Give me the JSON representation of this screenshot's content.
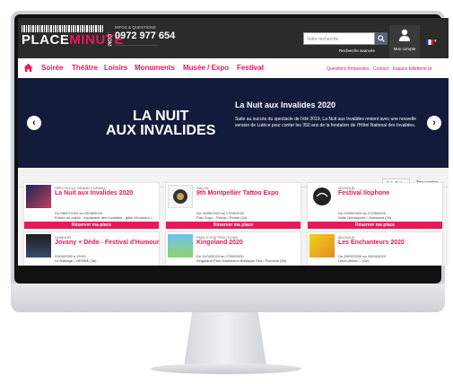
{
  "header": {
    "logo": {
      "place": "PLACE",
      "minute": "MINUTE",
      "dotcom": ".COM"
    },
    "infos_label": "INFOS & QUESTIONS",
    "phone": "0972 977 654",
    "search": {
      "placeholder": "Votre recherche",
      "button_icon": "search-icon",
      "advanced": "Recherche avancée"
    },
    "account_label": "Mon compte"
  },
  "nav": {
    "items": [
      "Soirée",
      "Théâtre",
      "Loisirs",
      "Monuments",
      "Musée / Expo",
      "Festival"
    ],
    "right": "Questions fréquentes · Contact · Espace billetterie pr"
  },
  "hero": {
    "image_title_line1": "LA NUIT",
    "image_title_line2": "AUX INVALIDES",
    "title": "La Nuit aux Invalides 2020",
    "description": "Suite au succès du spectacle de l'été 2019, La Nuit aux Invalides revient avec une nouvelle version de Lutèce pour conter les 350 ans de la fondation de l'Hôtel National des Invalides."
  },
  "tabs": [
    "A l'affiche",
    "Top ventes"
  ],
  "cards": [
    {
      "category": "SPECTACLE GRAND FORMAT",
      "title": "La Nuit aux Invalides 2020",
      "date": "Du 08/07/2020 au 29/08/2020",
      "place": "Entrée du public : esplanade des Invalides - grille d'honneur /...",
      "button": "Réserver ma place"
    },
    {
      "category": "SALON",
      "title": "9th Montpellier Tattoo Expo",
      "date": "Du 16/05/2020 au 17/05/2020",
      "place": "Parc Expo - Pérols / Pérols (34)",
      "button": "Réserver ma place"
    },
    {
      "category": "MUSIQUE",
      "title": "Festival Ilophone",
      "date": "Du 02/09/2020 au 27/09/2020",
      "place": "Salle Omnisports / Ouessant (29)",
      "button": "Réserver ma place"
    },
    {
      "category": "HUMOUR",
      "title": "Jovany + Dédo - Festival d'Humour",
      "date": "03/04/2020 à 20:00",
      "place": "Le Manège / VIENNE (38)",
      "button": ""
    },
    {
      "category": "PARCS D'ATTRACTIONS",
      "title": "Kingoland 2020",
      "date": "Du 11/04/2020 au 27/09/2020",
      "place": "Kingoland Parc d'attraction Bretagne Sud / Plumelin (56)",
      "button": ""
    },
    {
      "category": "MUSIQUE",
      "title": "Les Enchanteurs 2020",
      "date": "Du 28/02/2020 au 30/04/2020",
      "place": "Lieux divers / - (62)",
      "button": ""
    }
  ]
}
